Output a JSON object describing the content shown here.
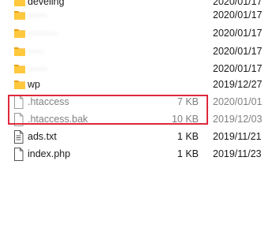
{
  "file_list": [
    {
      "type": "folder",
      "name": "develing",
      "size": "",
      "date": "2020/01/17",
      "blurred": false
    },
    {
      "type": "folder",
      "name": "------",
      "size": "",
      "date": "2020/01/17",
      "blurred": true
    },
    {
      "type": "folder",
      "name": "---------",
      "size": "",
      "date": "2020/01/17",
      "blurred": true
    },
    {
      "type": "folder",
      "name": "-----",
      "size": "",
      "date": "2020/01/17",
      "blurred": true
    },
    {
      "type": "folder",
      "name": "------",
      "size": "",
      "date": "2020/01/17",
      "blurred": true
    },
    {
      "type": "folder",
      "name": "wp",
      "size": "",
      "date": "2019/12/27",
      "blurred": false
    },
    {
      "type": "file",
      "name": ".htaccess",
      "size": "7 KB",
      "date": "2020/01/01",
      "dim": true
    },
    {
      "type": "file",
      "name": ".htaccess.bak",
      "size": "10 KB",
      "date": "2019/12/03",
      "dim": true
    },
    {
      "type": "text-file",
      "name": "ads.txt",
      "size": "1 KB",
      "date": "2019/11/21",
      "dim": false
    },
    {
      "type": "file",
      "name": "index.php",
      "size": "1 KB",
      "date": "2019/11/23",
      "dim": false
    }
  ],
  "colors": {
    "folder": "#ffc83d",
    "folder_dark": "#e8a317",
    "highlight": "#e0283a"
  }
}
